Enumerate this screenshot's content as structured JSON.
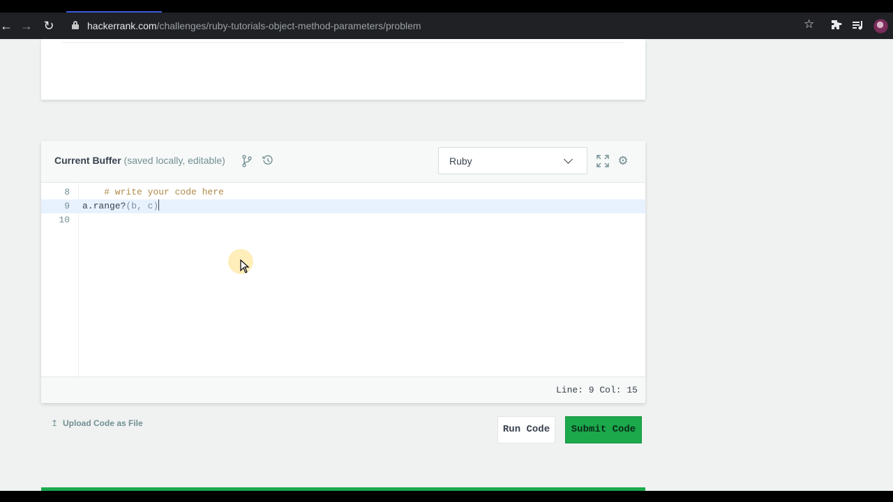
{
  "browser": {
    "url_host": "hackerrank.com",
    "url_path": "/challenges/ruby-tutorials-object-method-parameters/problem",
    "icons": [
      "back-icon",
      "forward-icon",
      "reload-icon",
      "lock-icon",
      "star-icon",
      "extensions-icon",
      "media-control-icon",
      "profile-avatar"
    ]
  },
  "editor": {
    "title": "Current Buffer",
    "subtitle": " (saved locally, editable)",
    "language": "Ruby",
    "lines": [
      {
        "number": "8",
        "text": "    # write your code here"
      },
      {
        "number": "9",
        "text_a": "a.range?",
        "text_b": "(b, c)"
      },
      {
        "number": "10",
        "text": ""
      }
    ],
    "status": "Line: 9 Col: 15"
  },
  "actions": {
    "upload_label": "Upload Code as File",
    "run_label": "Run Code",
    "submit_label": "Submit Code"
  },
  "colors": {
    "accent_green": "#1ba94c",
    "text_dark": "#39424e",
    "text_muted": "#738f93",
    "active_line": "#e8f2fe"
  }
}
